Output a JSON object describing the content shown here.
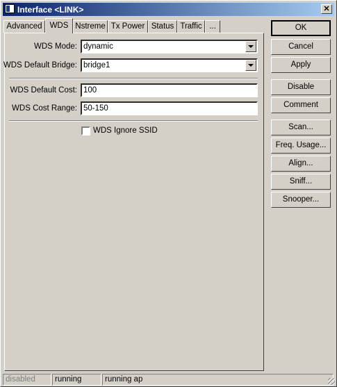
{
  "window": {
    "title": "Interface <LINK>",
    "close_glyph": "✕"
  },
  "tabs": [
    {
      "label": "Advanced",
      "active": false
    },
    {
      "label": "WDS",
      "active": true
    },
    {
      "label": "Nstreme",
      "active": false
    },
    {
      "label": "Tx Power",
      "active": false
    },
    {
      "label": "Status",
      "active": false
    },
    {
      "label": "Traffic",
      "active": false
    },
    {
      "label": "...",
      "active": false
    }
  ],
  "wds": {
    "mode_label": "WDS Mode:",
    "mode_value": "dynamic",
    "bridge_label": "WDS Default Bridge:",
    "bridge_value": "bridge1",
    "cost_label": "WDS Default Cost:",
    "cost_value": "100",
    "range_label": "WDS Cost Range:",
    "range_value": "50-150",
    "ignore_ssid_label": "WDS Ignore SSID",
    "ignore_ssid_checked": false
  },
  "buttons": {
    "ok": "OK",
    "cancel": "Cancel",
    "apply": "Apply",
    "disable": "Disable",
    "comment": "Comment",
    "scan": "Scan...",
    "freq_usage": "Freq. Usage...",
    "align": "Align...",
    "sniff": "Sniff...",
    "snooper": "Snooper..."
  },
  "statusbar": {
    "state": "disabled",
    "running": "running",
    "running_ap": "running ap"
  },
  "colors": {
    "titlebar_start": "#0a246a",
    "titlebar_end": "#a6caf0",
    "face": "#d4d0c8",
    "disabled_text": "#808080"
  }
}
